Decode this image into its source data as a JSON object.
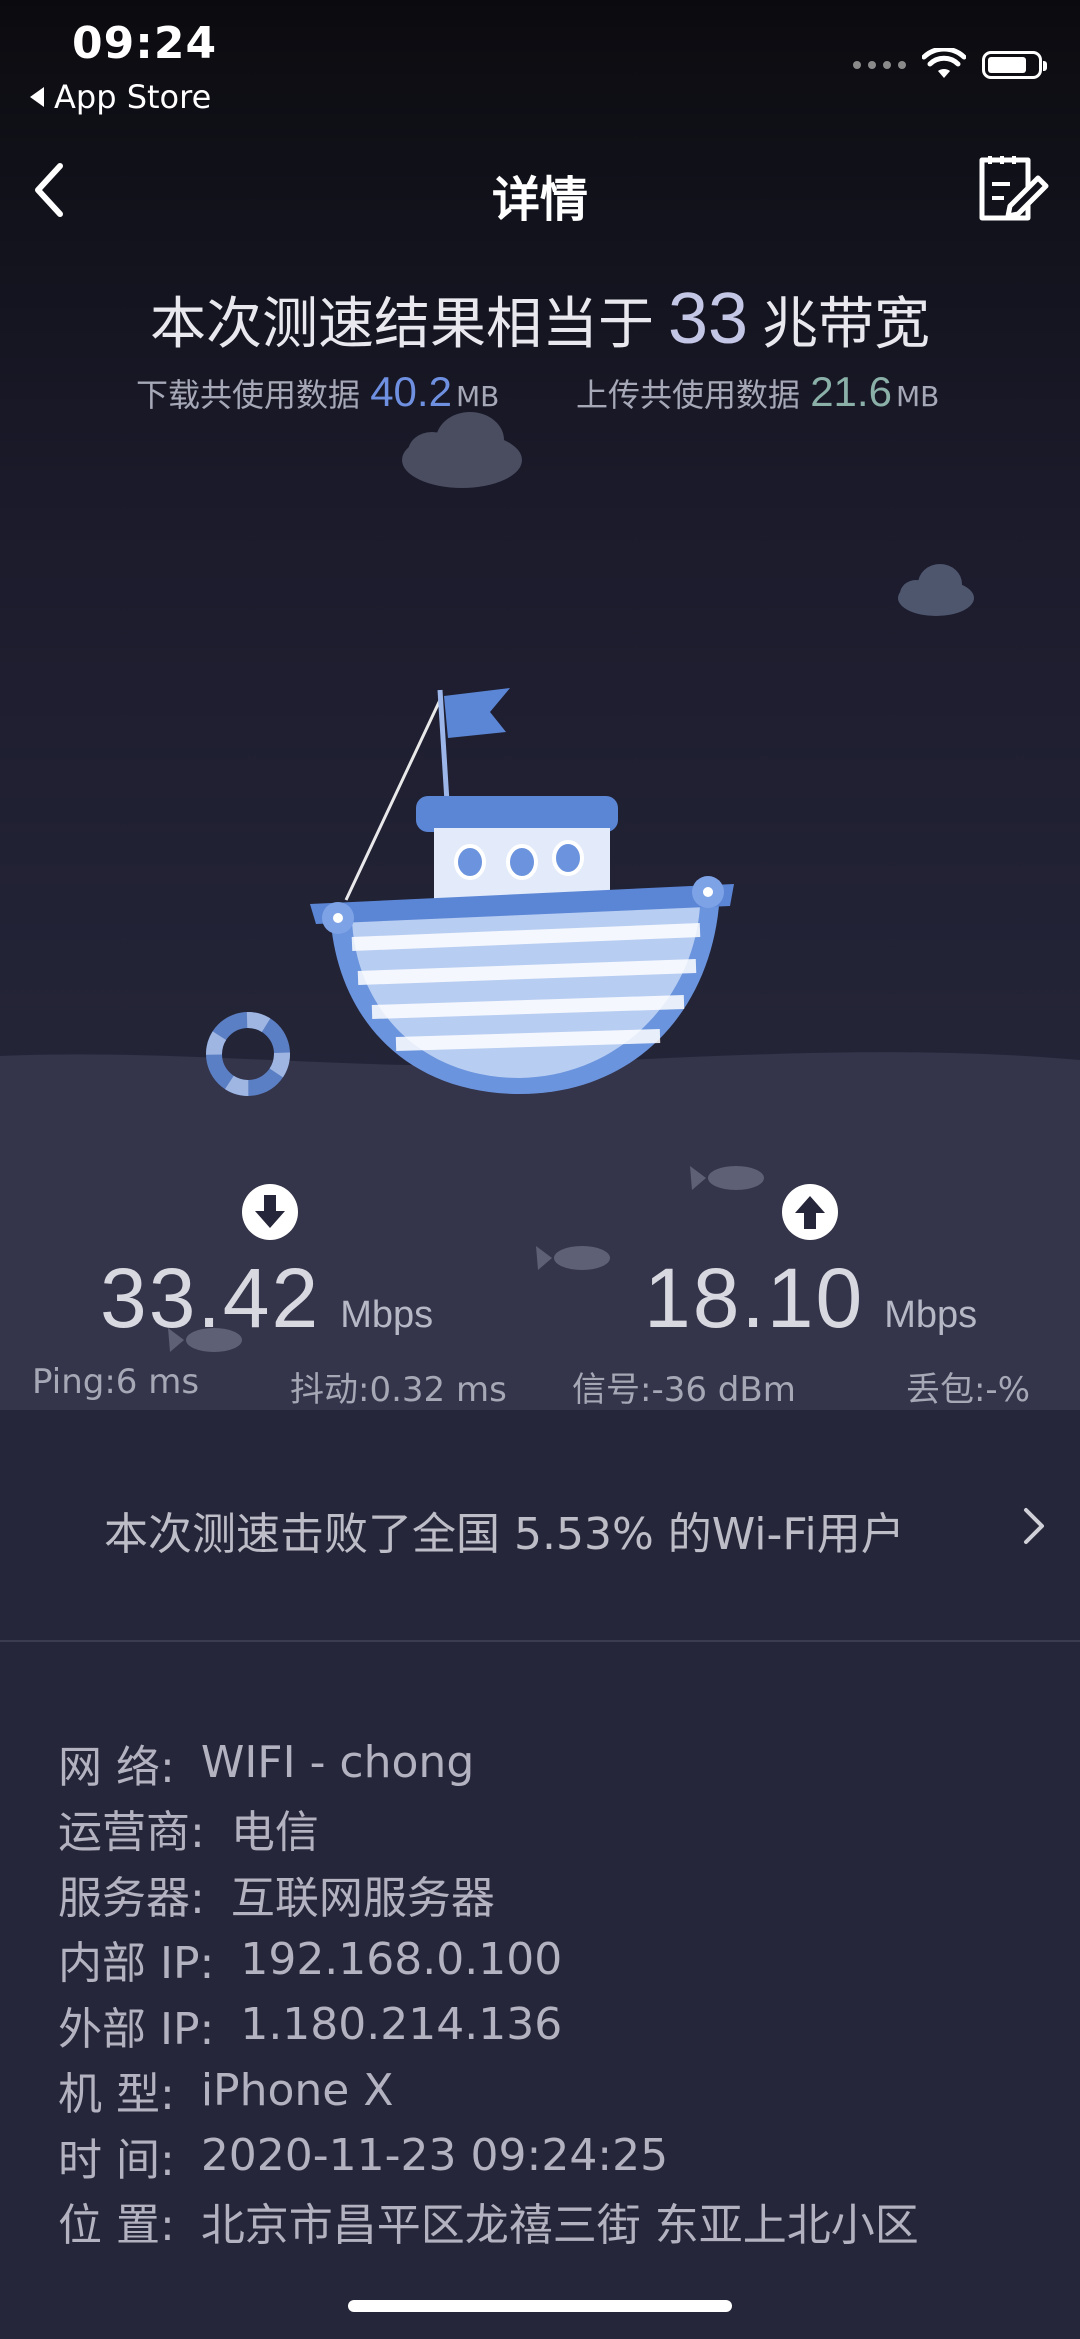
{
  "status_bar": {
    "time": "09:24",
    "back_app": "App Store",
    "wifi_icon": "wifi-icon",
    "battery_icon": "battery-icon"
  },
  "nav": {
    "title": "详情",
    "back_icon": "chevron-left-icon",
    "edit_icon": "edit-note-icon"
  },
  "summary": {
    "prefix": "本次测速结果相当于",
    "bandwidth": "33",
    "suffix": "兆带宽",
    "download_label": "下载共使用数据",
    "download_value": "40.2",
    "download_unit": "MB",
    "upload_label": "上传共使用数据",
    "upload_value": "21.6",
    "upload_unit": "MB"
  },
  "speeds": {
    "download": {
      "value": "33.42",
      "unit": "Mbps",
      "icon": "arrow-down-circle-icon"
    },
    "upload": {
      "value": "18.10",
      "unit": "Mbps",
      "icon": "arrow-up-circle-icon"
    }
  },
  "metrics": {
    "ping": "Ping:6 ms",
    "jitter": "抖动:0.32 ms",
    "signal": "信号:-36 dBm",
    "loss": "丢包:-%"
  },
  "beat": {
    "text": "本次测速击败了全国 5.53% 的Wi-Fi用户",
    "chevron_icon": "chevron-right-icon"
  },
  "info": [
    {
      "label": "网 络:",
      "value": "WIFI - chong"
    },
    {
      "label": "运营商:",
      "value": "电信"
    },
    {
      "label": "服务器:",
      "value": "互联网服务器"
    },
    {
      "label": "内部 IP:",
      "value": "192.168.0.100"
    },
    {
      "label": "外部 IP:",
      "value": "1.180.214.136"
    },
    {
      "label": "机 型:",
      "value": "iPhone X"
    },
    {
      "label": "时 间:",
      "value": "2020-11-23 09:24:25"
    },
    {
      "label": "位 置:",
      "value": "北京市昌平区龙禧三街 东亚上北小区"
    }
  ],
  "colors": {
    "background": "#26263a",
    "download_accent": "#6f90e0",
    "upload_accent": "#8ab0a8",
    "boat_blue": "#5b86d6"
  }
}
